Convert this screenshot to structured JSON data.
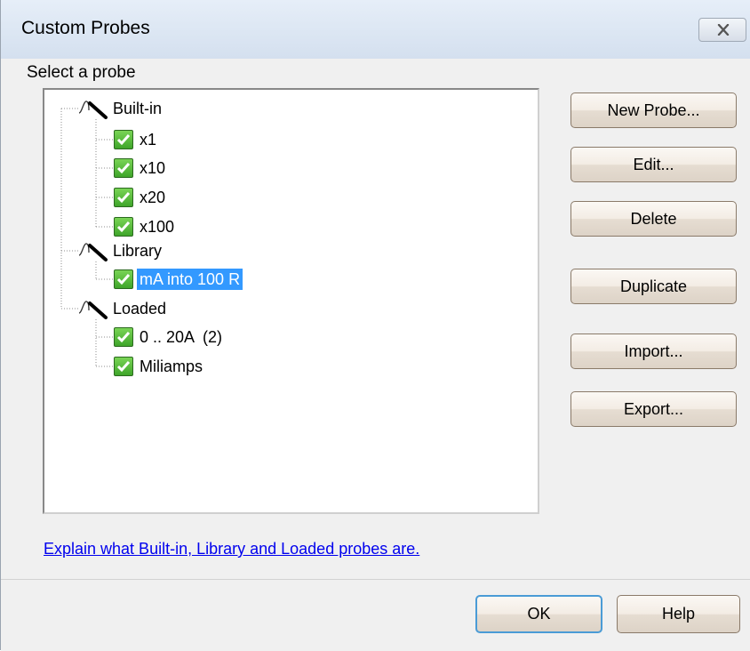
{
  "window": {
    "title": "Custom Probes"
  },
  "tree": {
    "label": "Select a probe",
    "groups": [
      {
        "label": "Built-in",
        "items": [
          "x1",
          "x10",
          "x20",
          "x100"
        ]
      },
      {
        "label": "Library",
        "items": [
          "mA into 100 R"
        ]
      },
      {
        "label": "Loaded",
        "items": [
          "0 .. 20A  (2)",
          "Miliamps"
        ]
      }
    ],
    "selected": "mA into 100 R"
  },
  "buttons": {
    "new_probe": "New Probe...",
    "edit": "Edit...",
    "delete": "Delete",
    "duplicate": "Duplicate",
    "import": "Import...",
    "export": "Export..."
  },
  "link": "Explain what Built-in, Library and Loaded probes are.",
  "footer": {
    "ok": "OK",
    "help": "Help"
  },
  "colors": {
    "selection": "#3399ff",
    "checkbox": "#4caf2f",
    "link": "#0000ee"
  }
}
